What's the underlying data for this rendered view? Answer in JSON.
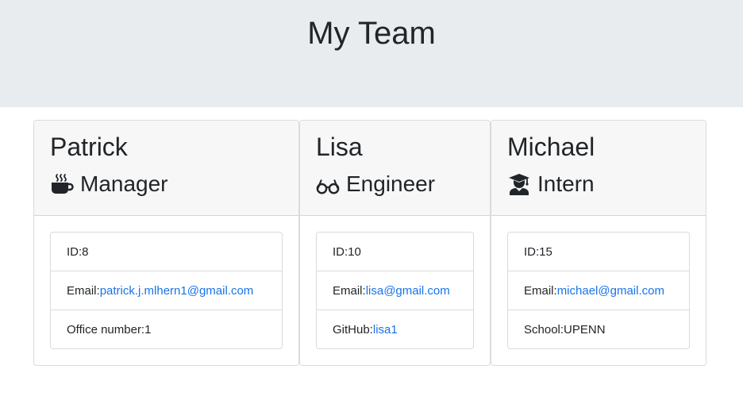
{
  "page": {
    "title": "My Team",
    "colors": {
      "header_bg": "#e9ecef",
      "card_header_bg": "#f7f7f7",
      "link": "#1a73e8",
      "text": "#212529"
    }
  },
  "team": [
    {
      "name": "Patrick",
      "role": "Manager",
      "icon": "coffee-mug-icon",
      "id_label": "ID: ",
      "id": "8",
      "email_label": "Email: ",
      "email": "patrick.j.mlhern1@gmail.com",
      "extra_label": "Office number: ",
      "extra_value": "1"
    },
    {
      "name": "Lisa",
      "role": "Engineer",
      "icon": "glasses-icon",
      "id_label": "ID: ",
      "id": "10",
      "email_label": "Email: ",
      "email": "lisa@gmail.com",
      "extra_label": "GitHub: ",
      "extra_value": "lisa1"
    },
    {
      "name": "Michael",
      "role": "Intern",
      "icon": "graduate-icon",
      "id_label": "ID: ",
      "id": "15",
      "email_label": "Email: ",
      "email": "michael@gmail.com",
      "extra_label": "School: ",
      "extra_value": "UPENN"
    }
  ]
}
